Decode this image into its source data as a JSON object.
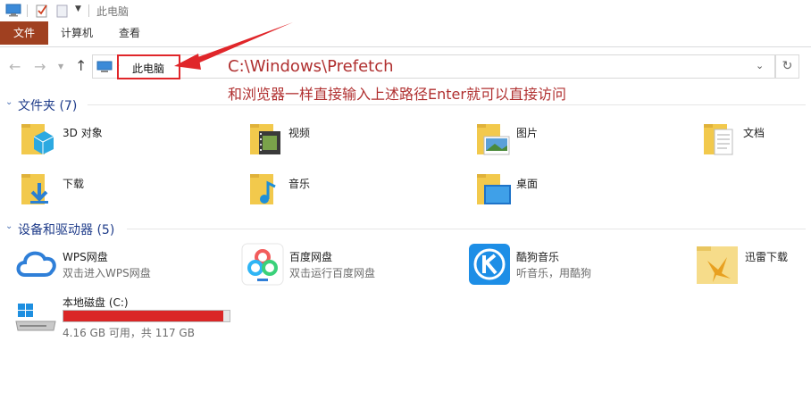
{
  "window": {
    "title": "此电脑"
  },
  "ribbon": {
    "tabs": [
      "文件",
      "计算机",
      "查看"
    ]
  },
  "address": {
    "crumb": "此电脑"
  },
  "annotation": {
    "line1": "C:\\Windows\\Prefetch",
    "line2": "和浏览器一样直接输入上述路径Enter就可以直接访问"
  },
  "folders_group": {
    "header": "文件夹 (7)",
    "items": [
      {
        "label": "3D 对象",
        "icon": "3d-objects-folder-icon"
      },
      {
        "label": "视频",
        "icon": "videos-folder-icon"
      },
      {
        "label": "图片",
        "icon": "pictures-folder-icon"
      },
      {
        "label": "文档",
        "icon": "documents-folder-icon"
      },
      {
        "label": "下载",
        "icon": "downloads-folder-icon"
      },
      {
        "label": "音乐",
        "icon": "music-folder-icon"
      },
      {
        "label": "桌面",
        "icon": "desktop-folder-icon"
      }
    ]
  },
  "devices_group": {
    "header": "设备和驱动器 (5)",
    "items": [
      {
        "label": "WPS网盘",
        "sub": "双击进入WPS网盘",
        "icon": "wps-cloud-icon"
      },
      {
        "label": "百度网盘",
        "sub": "双击运行百度网盘",
        "icon": "baidu-netdisk-icon"
      },
      {
        "label": "酷狗音乐",
        "sub": "听音乐，用酷狗",
        "icon": "kugou-music-icon"
      },
      {
        "label": "迅雷下载",
        "sub": "",
        "icon": "xunlei-download-icon"
      }
    ],
    "drive": {
      "label": "本地磁盘 (C:)",
      "free_text": "4.16 GB 可用，共 117 GB",
      "used_fraction": 0.964,
      "bar_color": "#da2626"
    }
  },
  "colors": {
    "accent": "#a04020",
    "highlight": "#e0262a",
    "annotation": "#b03030",
    "group_header": "#1f3c8a"
  }
}
